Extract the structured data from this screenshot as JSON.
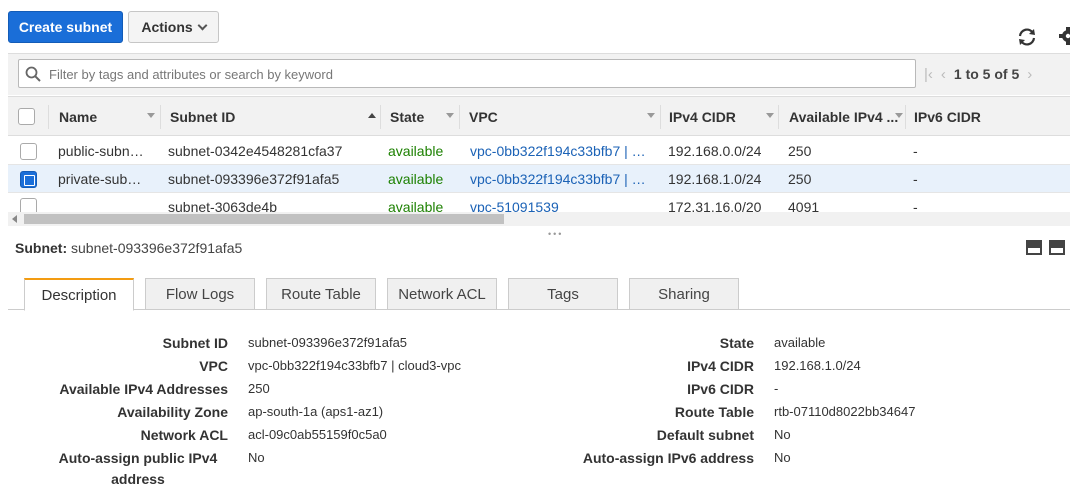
{
  "toolbar": {
    "create_label": "Create subnet",
    "actions_label": "Actions"
  },
  "icons": {
    "refresh": "refresh-icon",
    "settings": "gear-icon",
    "search": "search-icon",
    "first": "first-page-icon",
    "prev": "prev-page-icon",
    "next": "next-page-icon"
  },
  "filter": {
    "placeholder": "Filter by tags and attributes or search by keyword"
  },
  "pagination": {
    "text": "1 to 5 of 5"
  },
  "table": {
    "columns": [
      "Name",
      "Subnet ID",
      "State",
      "VPC",
      "IPv4 CIDR",
      "Available IPv4 ...",
      "IPv6 CIDR"
    ],
    "rows": [
      {
        "selected": false,
        "name": "public-subn…",
        "subnet_id": "subnet-0342e4548281cfa37",
        "state": "available",
        "vpc": "vpc-0bb322f194c33bfb7 | …",
        "ipv4": "192.168.0.0/24",
        "avail": "250",
        "ipv6": "-"
      },
      {
        "selected": true,
        "name": "private-sub…",
        "subnet_id": "subnet-093396e372f91afa5",
        "state": "available",
        "vpc": "vpc-0bb322f194c33bfb7 | …",
        "ipv4": "192.168.1.0/24",
        "avail": "250",
        "ipv6": "-"
      },
      {
        "selected": false,
        "name": "",
        "subnet_id": "subnet-3063de4b",
        "state": "available",
        "vpc": "vpc-51091539",
        "ipv4": "172.31.16.0/20",
        "avail": "4091",
        "ipv6": "-"
      }
    ]
  },
  "detail": {
    "title_label": "Subnet:",
    "title_value": "subnet-093396e372f91afa5",
    "tabs": [
      "Description",
      "Flow Logs",
      "Route Table",
      "Network ACL",
      "Tags",
      "Sharing"
    ],
    "left": [
      {
        "label": "Subnet ID",
        "value": "subnet-093396e372f91afa5"
      },
      {
        "label": "VPC",
        "value": "vpc-0bb322f194c33bfb7 | cloud3-vpc"
      },
      {
        "label": "Available IPv4 Addresses",
        "value": "250"
      },
      {
        "label": "Availability Zone",
        "value": "ap-south-1a (aps1-az1)"
      },
      {
        "label": "Network ACL",
        "value": "acl-09c0ab55159f0c5a0"
      },
      {
        "label": "Auto-assign public IPv4 address",
        "value": "No"
      }
    ],
    "right": [
      {
        "label": "State",
        "value": "available"
      },
      {
        "label": "IPv4 CIDR",
        "value": "192.168.1.0/24"
      },
      {
        "label": "IPv6 CIDR",
        "value": "-"
      },
      {
        "label": "Route Table",
        "value": "rtb-07110d8022bb34647"
      },
      {
        "label": "Default subnet",
        "value": "No"
      },
      {
        "label": "Auto-assign IPv6 address",
        "value": "No"
      }
    ]
  },
  "colors": {
    "primary": "#1a6ed8",
    "link": "#1b62b6",
    "available": "#1d8102",
    "tab_accent": "#f39c12",
    "selected_row": "#e8f1fb"
  }
}
